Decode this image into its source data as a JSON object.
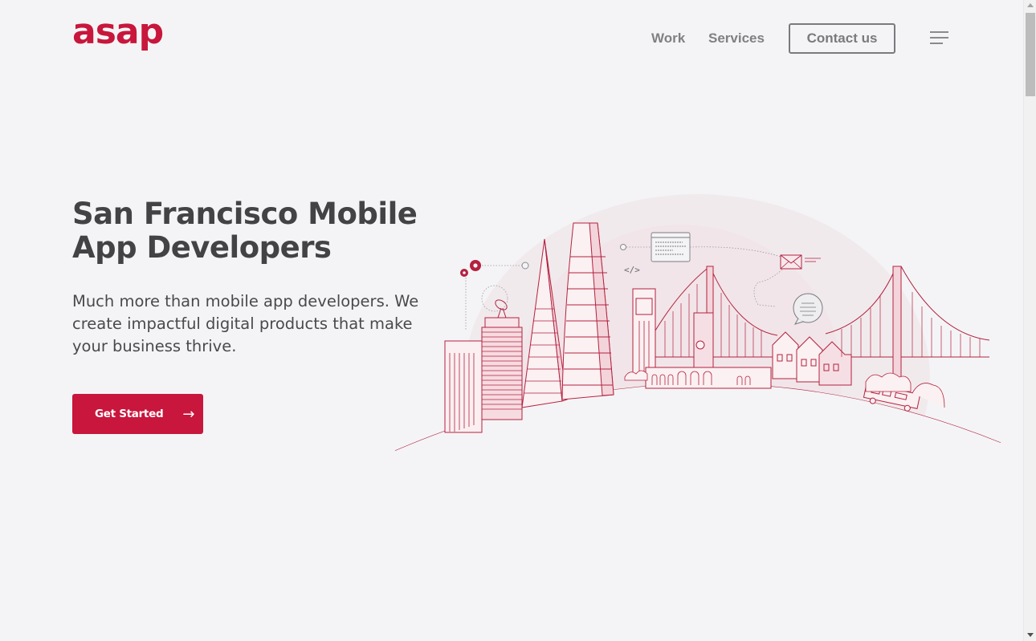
{
  "brand": {
    "logo_text": "asap",
    "accent_color": "#c8163c"
  },
  "nav": {
    "links": [
      {
        "label": "Work"
      },
      {
        "label": "Services"
      }
    ],
    "contact_label": "Contact us",
    "menu_icon": "hamburger-menu-icon"
  },
  "hero": {
    "title_line1": "San Francisco Mobile",
    "title_line2": "App Developers",
    "subtitle": "Much more than mobile app developers. We create impactful digital products that make your business thrive.",
    "cta_label": "Get Started",
    "cta_icon": "arrow-right-icon",
    "illustration": {
      "description": "San Francisco skyline line illustration with bridges, towers, houses and cable car",
      "code_tag": "</>"
    }
  }
}
